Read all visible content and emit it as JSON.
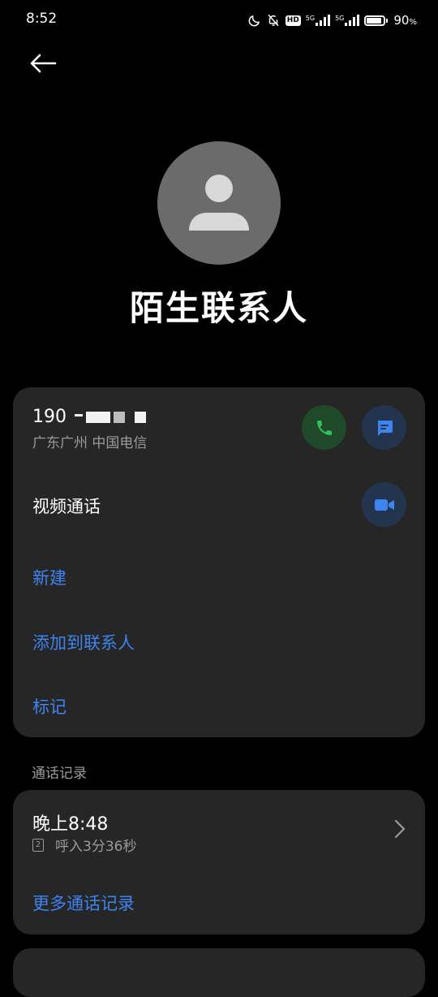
{
  "status_bar": {
    "time": "8:52",
    "hd_label": "HD",
    "sim1_label": "5G",
    "sim2_label": "5G",
    "battery_value": "90",
    "battery_unit": "%",
    "battery_level": 0.9,
    "icons": [
      "moon-icon",
      "bell-off-icon",
      "signal-icon",
      "battery-icon"
    ]
  },
  "header": {
    "back_icon": "arrow-left-icon"
  },
  "contact": {
    "name": "陌生联系人",
    "avatar_icon": "person-icon"
  },
  "number_card": {
    "number_prefix": "190",
    "location": "广东广州 中国电信",
    "call_icon": "phone-icon",
    "message_icon": "message-icon",
    "video_call_label": "视频通话",
    "video_icon": "video-camera-icon",
    "actions": {
      "new": "新建",
      "add_to_contacts": "添加到联系人",
      "mark": "标记"
    }
  },
  "call_log": {
    "section_title": "通话记录",
    "entry_time": "晚上8:48",
    "sim_slot": "2",
    "entry_detail": "呼入3分36秒",
    "more_label": "更多通话记录"
  },
  "colors": {
    "background": "#000000",
    "card": "#262626",
    "accent_blue": "#3d84f0",
    "call_green": "#2fc15a",
    "danger_red": "#e0433a",
    "muted_text": "#9a9a9a"
  }
}
